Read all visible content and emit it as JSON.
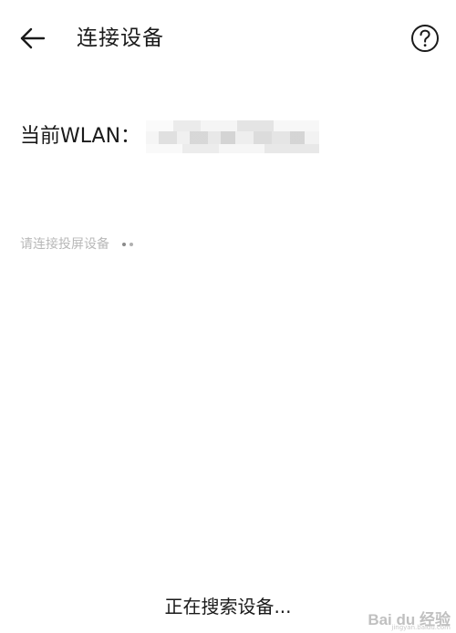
{
  "header": {
    "back_icon": "arrow-left-icon",
    "title": "连接设备",
    "help_icon": "question-circle-icon"
  },
  "wlan": {
    "label": "当前WLAN："
  },
  "hint": {
    "text": "请连接投屏设备",
    "loading_icon": "loading-dots-icon"
  },
  "footer": {
    "status": "正在搜索设备..."
  },
  "watermark": {
    "brand": "Bai du 经验",
    "domain": "jingyan.baidu.com"
  }
}
